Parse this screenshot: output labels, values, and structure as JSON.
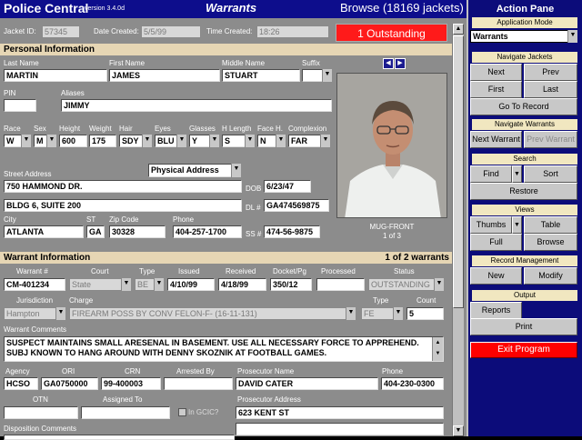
{
  "app": {
    "title": "Police Central",
    "version": "version 3.4.0d",
    "section": "Warrants",
    "mode": "Browse (18169 jackets)"
  },
  "jacket": {
    "id_label": "Jacket ID:",
    "id": "57345",
    "created_label": "Date Created:",
    "created": "5/5/99",
    "time_label": "Time Created:",
    "time": "18:26",
    "outstanding": "1 Outstanding"
  },
  "personal": {
    "heading": "Personal Information",
    "last_label": "Last Name",
    "last": "MARTIN",
    "first_label": "First Name",
    "first": "JAMES",
    "middle_label": "Middle Name",
    "middle": "STUART",
    "suffix_label": "Suffix",
    "suffix": "",
    "pin_label": "PIN",
    "pin": "",
    "aliases_label": "Aliases",
    "aliases": "JIMMY",
    "race_label": "Race",
    "race": "W",
    "sex_label": "Sex",
    "sex": "M",
    "height_label": "Height",
    "height": "600",
    "weight_label": "Weight",
    "weight": "175",
    "hair_label": "Hair",
    "hair": "SDY",
    "eyes_label": "Eyes",
    "eyes": "BLU",
    "glasses_label": "Glasses",
    "glasses": "Y",
    "hlength_label": "H Length",
    "hlength": "S",
    "faceh_label": "Face H.",
    "faceh": "N",
    "complexion_label": "Complexion",
    "complexion": "FAR",
    "street_label": "Street Address",
    "address_type": "Physical Address",
    "street1": "750 HAMMOND DR.",
    "street2": "BLDG 6, SUITE 200",
    "dob_label": "DOB",
    "dob": "6/23/47",
    "dl_label": "DL #",
    "dl": "GA474569875",
    "city_label": "City",
    "city": "ATLANTA",
    "st_label": "ST",
    "st": "GA",
    "zip_label": "Zip Code",
    "zip": "30328",
    "phone_label": "Phone",
    "phone": "404-257-1700",
    "ss_label": "SS #",
    "ss": "474-56-9875",
    "photo_caption": "MUG-FRONT",
    "photo_count": "1 of 3"
  },
  "warrant": {
    "heading": "Warrant Information",
    "count_text": "1 of 2 warrants",
    "num_label": "Warrant #",
    "num": "CM-401234",
    "court_label": "Court",
    "court": "State",
    "type_label": "Type",
    "type": "BE",
    "issued_label": "Issued",
    "issued": "4/10/99",
    "received_label": "Received",
    "received": "4/18/99",
    "docket_label": "Docket/Pg",
    "docket": "350/12",
    "processed_label": "Processed",
    "processed": "",
    "status_label": "Status",
    "status": "OUTSTANDING",
    "jurisdiction_label": "Jurisdiction",
    "jurisdiction": "Hampton",
    "charge_label": "Charge",
    "charge": "FIREARM POSS BY CONV FELON-F- (16-11-131)",
    "ctype_label": "Type",
    "ctype": "FE",
    "count_label": "Count",
    "count": "5",
    "comments_label": "Warrant Comments",
    "comments1": "SUSPECT MAINTAINS SMALL ARESENAL IN BASEMENT.  USE ALL NECESSARY FORCE TO APPREHEND.",
    "comments2": "SUBJ KNOWN TO HANG AROUND WITH DENNY SKOZNIK AT FOOTBALL GAMES.",
    "agency_label": "Agency",
    "agency": "HCSO",
    "ori_label": "ORI",
    "ori": "GA0750000",
    "crn_label": "CRN",
    "crn": "99-400003",
    "arrested_label": "Arrested By",
    "arrested": "",
    "prosecutor_label": "Prosecutor Name",
    "prosecutor": "DAVID CATER",
    "pphone_label": "Phone",
    "pphone": "404-230-0300",
    "otn_label": "OTN",
    "otn": "",
    "assigned_label": "Assigned To",
    "assigned": "",
    "ingcic_label": "In GCIC?",
    "paddress_label": "Prosecutor Address",
    "paddress": "623 KENT ST",
    "disposition_label": "Disposition Comments"
  },
  "pane": {
    "title": "Action Pane",
    "appmode_hdr": "Application Mode",
    "appmode": "Warrants",
    "navjackets_hdr": "Navigate Jackets",
    "next": "Next",
    "prev": "Prev",
    "first": "First",
    "last": "Last",
    "goto": "Go To Record",
    "navwarrants_hdr": "Navigate Warrants",
    "next_warrant": "Next Warrant",
    "prev_warrant": "Prev Warrant",
    "search_hdr": "Search",
    "find": "Find",
    "sort": "Sort",
    "restore": "Restore",
    "views_hdr": "Views",
    "thumbs": "Thumbs",
    "table": "Table",
    "full": "Full",
    "browse": "Browse",
    "recmgmt_hdr": "Record Management",
    "new": "New",
    "modify": "Modify",
    "output_hdr": "Output",
    "reports": "Reports",
    "print": "Print",
    "exit": "Exit Program"
  },
  "colors": {
    "title_bar": "#0d0d8c",
    "pane_bg": "#0c0c7a",
    "content_bg": "#8c8c8c",
    "section_bar": "#e6d6b4",
    "outstanding_red": "#ff1a1a",
    "exit_red": "#ff0000"
  }
}
